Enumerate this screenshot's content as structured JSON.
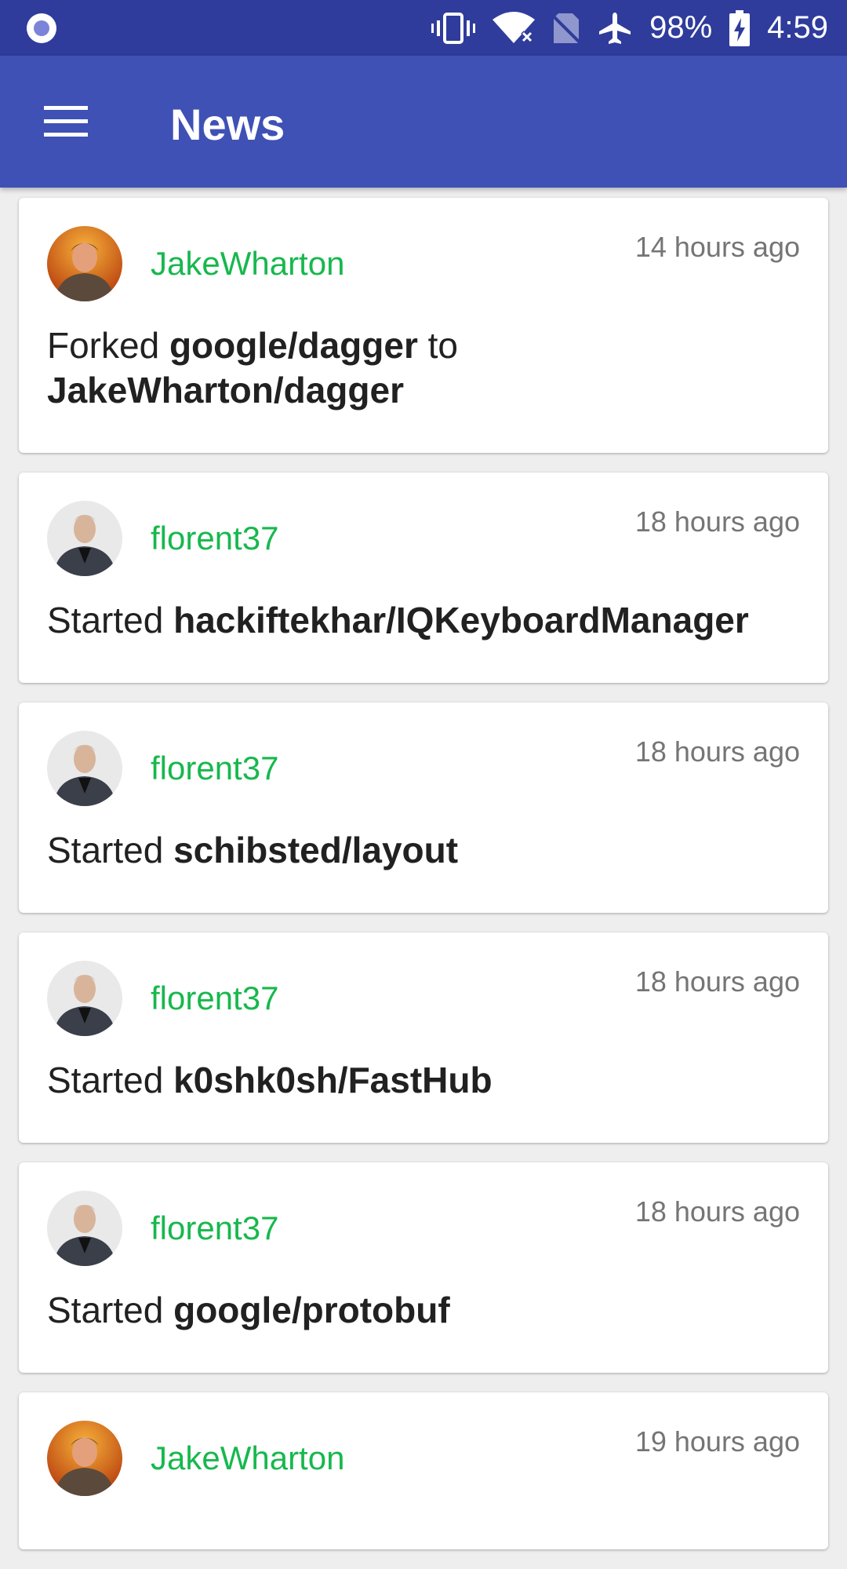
{
  "status_bar": {
    "battery": "98%",
    "time": "4:59"
  },
  "app_bar": {
    "title": "News"
  },
  "feed": [
    {
      "user": "JakeWharton",
      "avatar": "jake-avatar",
      "time": "14 hours ago",
      "verb": "Forked",
      "repo": "google/dagger",
      "connector": "to",
      "target": "JakeWharton/dagger"
    },
    {
      "user": "florent37",
      "avatar": "florent-avatar",
      "time": "18 hours ago",
      "verb": "Started",
      "repo": "hackiftekhar/IQKeyboardManager"
    },
    {
      "user": "florent37",
      "avatar": "florent-avatar",
      "time": "18 hours ago",
      "verb": "Started",
      "repo": "schibsted/layout"
    },
    {
      "user": "florent37",
      "avatar": "florent-avatar",
      "time": "18 hours ago",
      "verb": "Started",
      "repo": "k0shk0sh/FastHub"
    },
    {
      "user": "florent37",
      "avatar": "florent-avatar",
      "time": "18 hours ago",
      "verb": "Started",
      "repo": "google/protobuf"
    },
    {
      "user": "JakeWharton",
      "avatar": "jake-avatar",
      "time": "19 hours ago"
    }
  ],
  "colors": {
    "status_bar": "#2f3c9c",
    "app_bar": "#3f51b5",
    "username": "#17b84d",
    "timestamp": "#757575"
  }
}
